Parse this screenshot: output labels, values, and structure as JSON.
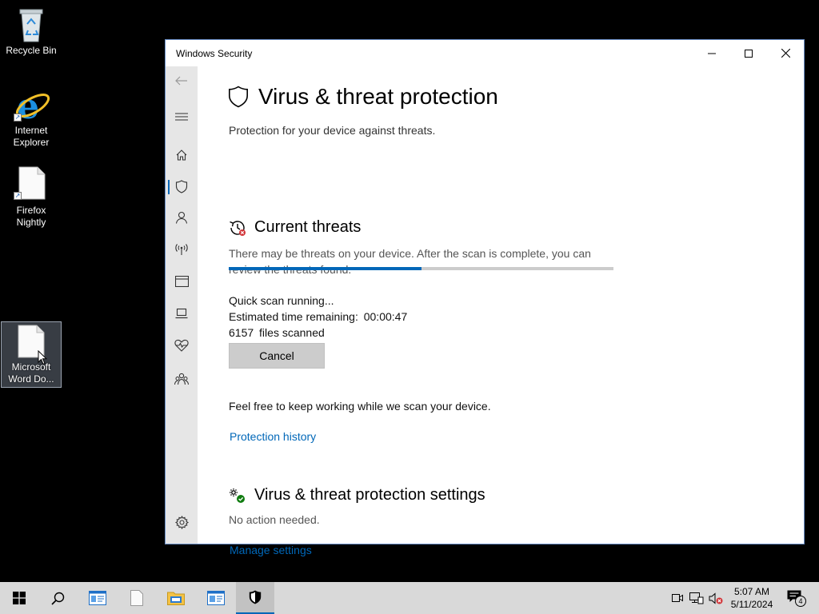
{
  "desktop": {
    "icons": [
      {
        "label": "Recycle Bin"
      },
      {
        "label": "Internet Explorer"
      },
      {
        "label": "Firefox Nightly"
      },
      {
        "label": "Microsoft Word Do..."
      }
    ]
  },
  "window": {
    "title": "Windows Security",
    "page_title": "Virus & threat protection",
    "page_subtitle": "Protection for your device against threats.",
    "current_threats": {
      "heading": "Current threats",
      "description": "There may be threats on your device. After the scan is complete, you can review the threats found.",
      "progress": 0.5,
      "scan_status": "Quick scan running...",
      "time_remaining_label": "Estimated time remaining:",
      "time_remaining_value": "00:00:47",
      "files_scanned_count": "6157",
      "files_scanned_label": "files scanned",
      "cancel_label": "Cancel",
      "keep_working_text": "Feel free to keep working while we scan your device.",
      "protection_history_link": "Protection history"
    },
    "settings_section": {
      "heading": "Virus & threat protection settings",
      "status": "No action needed.",
      "manage_link": "Manage settings"
    },
    "nav": [
      "back-arrow-icon",
      "hamburger-menu-icon",
      "home-icon",
      "shield-icon",
      "person-icon",
      "wireless-icon",
      "app-browser-icon",
      "laptop-icon",
      "heart-pulse-icon",
      "family-icon",
      "gear-icon"
    ]
  },
  "taskbar": {
    "time": "5:07 AM",
    "date": "5/11/2024",
    "notification_count": "4"
  },
  "colors": {
    "accent": "#0067b8",
    "nav_background": "#e6e6e6",
    "taskbar_background": "#d9d9d9"
  }
}
